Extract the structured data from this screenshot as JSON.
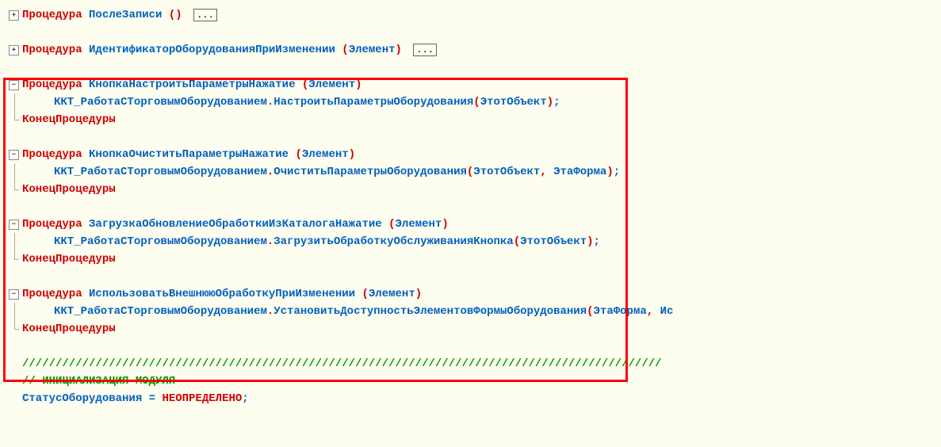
{
  "fold_plus": "+",
  "fold_minus": "−",
  "ellipsis": "...",
  "kw": {
    "procedure": "Процедура",
    "endprocedure": "КонецПроцедуры",
    "undefined": "НЕОПРЕДЕЛЕНО"
  },
  "procs": {
    "p1_name": "ПослеЗаписи",
    "p2_name": "ИдентификаторОборудованияПриИзменении",
    "p3_name": "КнопкаНастроитьПараметрыНажатие",
    "p4_name": "КнопкаОчиститьПараметрыНажатие",
    "p5_name": "ЗагрузкаОбновлениеОбработкиИзКаталогаНажатие",
    "p6_name": "ИспользоватьВнешнююОбработкуПриИзменении"
  },
  "params": {
    "element": "Элемент",
    "this_object": "ЭтотОбъект",
    "this_form": "ЭтаФорма",
    "is_trunc": "Ис"
  },
  "obj": {
    "kkt": "ККТ_РаботаСТорговымОборудованием",
    "m1": "НастроитьПараметрыОборудования",
    "m2": "ОчиститьПараметрыОборудования",
    "m3": "ЗагрузитьОбработкуОбслуживанияКнопка",
    "m4": "УстановитьДоступностьЭлементовФормыОборудования"
  },
  "footer": {
    "sep": "////////////////////////////////////////////////////////////////////////////////////////////////",
    "init": "// ИНИЦИАЛИЗАЦИЯ МОДУЛЯ",
    "var": "СтатусОборудования"
  }
}
